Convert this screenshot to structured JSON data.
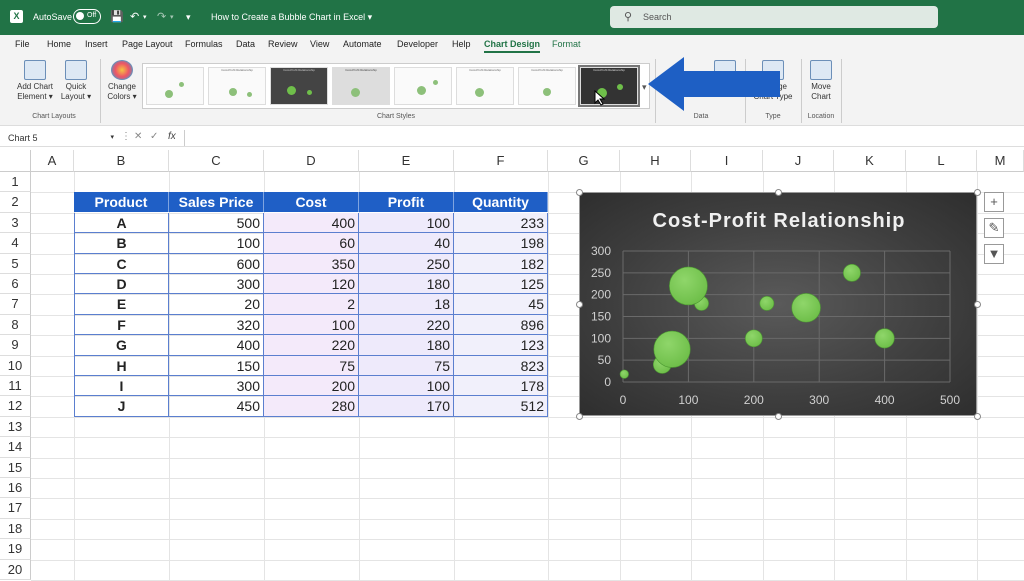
{
  "titlebar": {
    "autosave": "AutoSave",
    "toggle": "Off",
    "doc_title": "How to Create a Bubble Chart in Excel",
    "search": "Search"
  },
  "tabs": [
    "File",
    "Home",
    "Insert",
    "Page Layout",
    "Formulas",
    "Data",
    "Review",
    "View",
    "Automate",
    "Developer",
    "Help",
    "Chart Design",
    "Format"
  ],
  "ribbon": {
    "add_chart": [
      "Add Chart",
      "Element"
    ],
    "quick": [
      "Quick",
      "Layout"
    ],
    "change_colors": [
      "Change",
      "Colors"
    ],
    "data_btn": "Data",
    "change_type": [
      "Change",
      "Chart Type"
    ],
    "move": [
      "Move",
      "Chart"
    ],
    "groups": {
      "layouts": "Chart Layouts",
      "styles": "Chart Styles",
      "data": "Data",
      "type": "Type",
      "location": "Location"
    },
    "thumb_titles": [
      "",
      "Cost-Profit Relationship",
      "Cost-Profit Relationship",
      "Cost-Profit Relationship",
      "",
      "Cost-Profit Relationship",
      "Cost-Profit Relationship",
      "Cost-Profit Relationship"
    ]
  },
  "formula": {
    "namebox": "Chart 5",
    "fx": "fx"
  },
  "columns": [
    "A",
    "B",
    "C",
    "D",
    "E",
    "F",
    "G",
    "H",
    "I",
    "J",
    "K",
    "L",
    "M"
  ],
  "rows": [
    "1",
    "2",
    "3",
    "4",
    "5",
    "6",
    "7",
    "8",
    "9",
    "10",
    "11",
    "12",
    "13",
    "14",
    "15",
    "16",
    "17",
    "18",
    "19",
    "20"
  ],
  "table": {
    "headers": [
      "Product",
      "Sales Price",
      "Cost",
      "Profit",
      "Quantity"
    ],
    "rows": [
      [
        "A",
        "500",
        "400",
        "100",
        "233"
      ],
      [
        "B",
        "100",
        "60",
        "40",
        "198"
      ],
      [
        "C",
        "600",
        "350",
        "250",
        "182"
      ],
      [
        "D",
        "300",
        "120",
        "180",
        "125"
      ],
      [
        "E",
        "20",
        "2",
        "18",
        "45"
      ],
      [
        "F",
        "320",
        "100",
        "220",
        "896"
      ],
      [
        "G",
        "400",
        "220",
        "180",
        "123"
      ],
      [
        "H",
        "150",
        "75",
        "75",
        "823"
      ],
      [
        "I",
        "300",
        "200",
        "100",
        "178"
      ],
      [
        "J",
        "450",
        "280",
        "170",
        "512"
      ]
    ]
  },
  "chart_data": {
    "type": "scatter",
    "title": "Cost-Profit Relationship",
    "x_ticks": [
      "0",
      "100",
      "200",
      "300",
      "400",
      "500"
    ],
    "y_ticks": [
      "0",
      "50",
      "100",
      "150",
      "200",
      "250",
      "300"
    ],
    "xlim": [
      0,
      500
    ],
    "ylim": [
      0,
      300
    ],
    "points": [
      {
        "x": 400,
        "y": 100,
        "size": 233
      },
      {
        "x": 60,
        "y": 40,
        "size": 198
      },
      {
        "x": 350,
        "y": 250,
        "size": 182
      },
      {
        "x": 120,
        "y": 180,
        "size": 125
      },
      {
        "x": 2,
        "y": 18,
        "size": 45
      },
      {
        "x": 100,
        "y": 220,
        "size": 896
      },
      {
        "x": 220,
        "y": 180,
        "size": 123
      },
      {
        "x": 75,
        "y": 75,
        "size": 823
      },
      {
        "x": 200,
        "y": 100,
        "size": 178
      },
      {
        "x": 280,
        "y": 170,
        "size": 512
      }
    ],
    "bubble_color": "#6fbf4a",
    "background": "dark gradient",
    "grid": true
  },
  "side_buttons": [
    "plus-icon",
    "brush-icon",
    "filter-icon"
  ]
}
